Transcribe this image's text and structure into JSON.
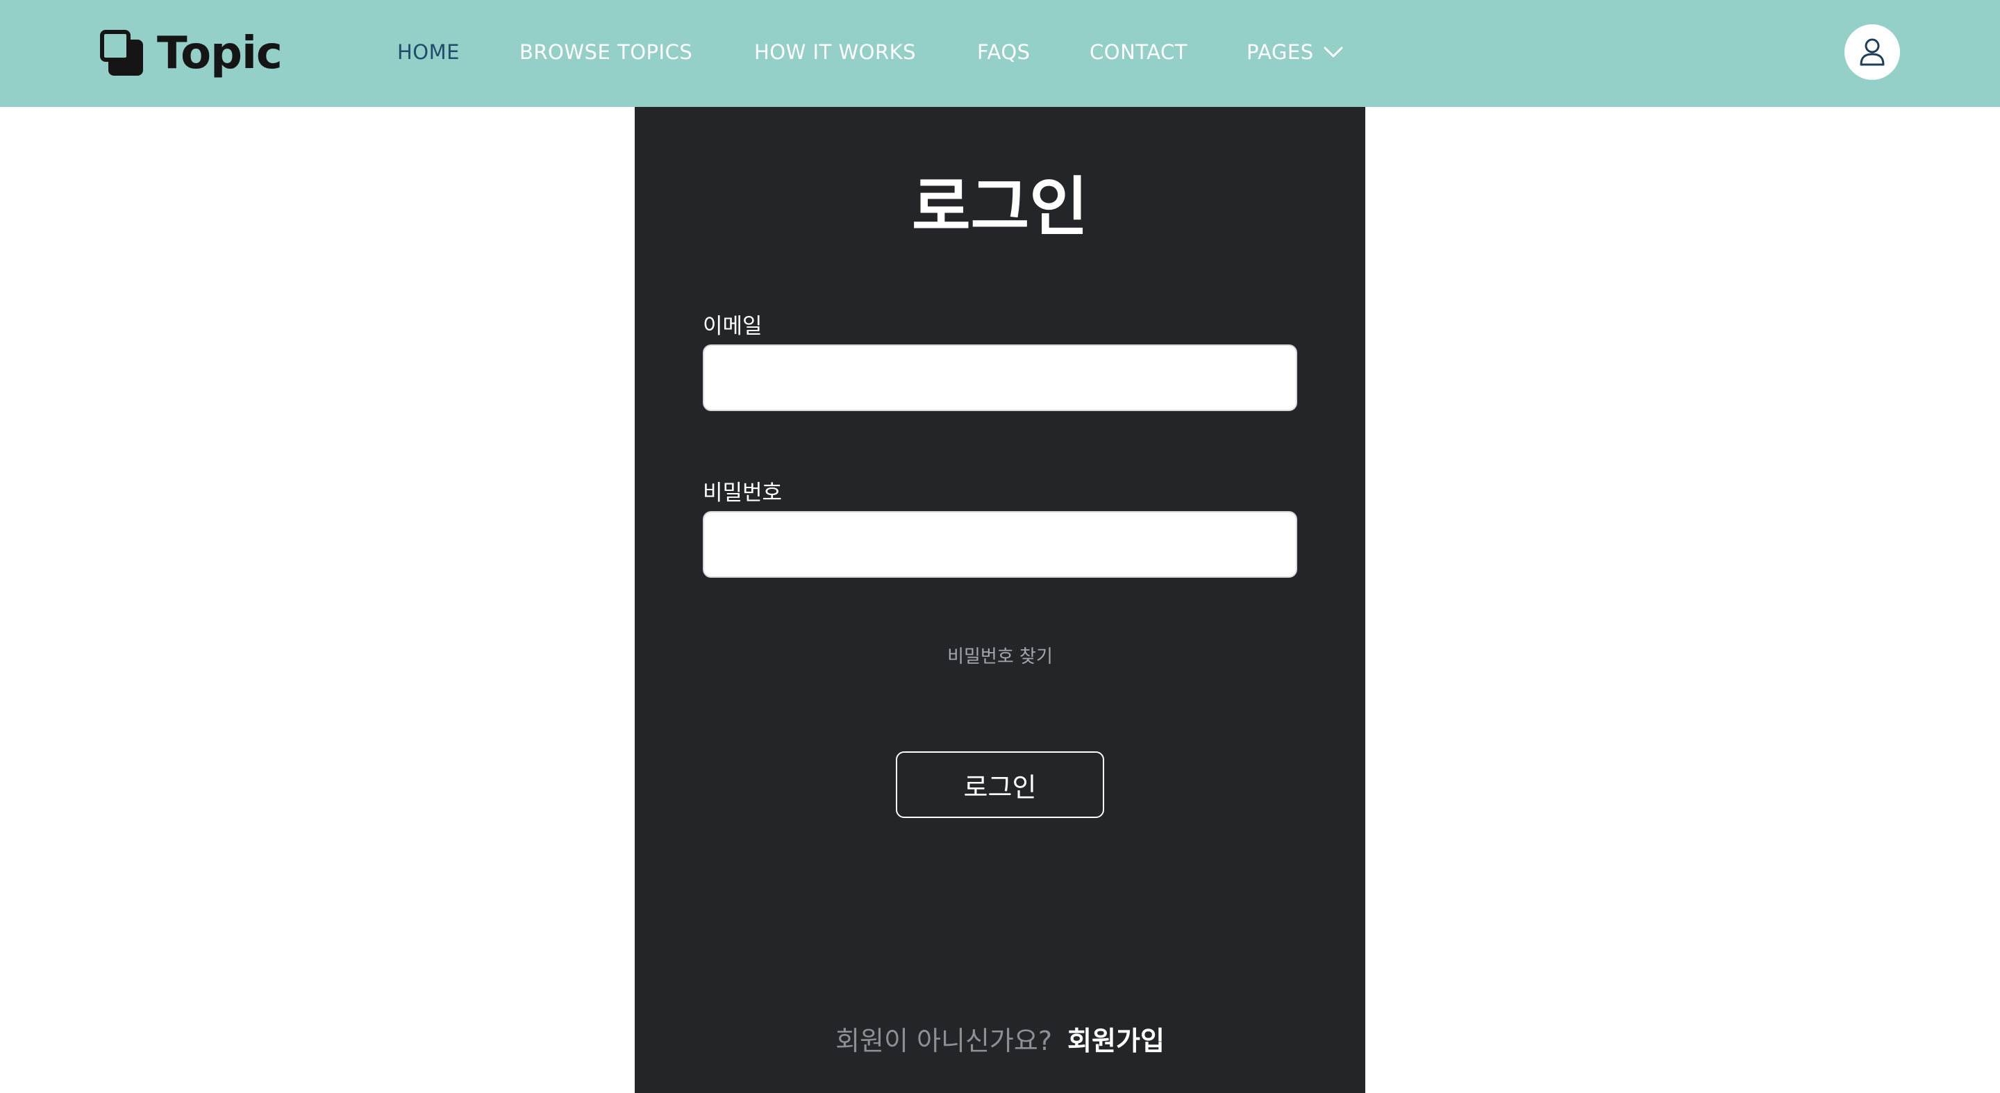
{
  "brand": {
    "name": "Topic",
    "icon": "stacked-squares-icon"
  },
  "nav": {
    "items": [
      {
        "label": "HOME",
        "active": true
      },
      {
        "label": "BROWSE TOPICS"
      },
      {
        "label": "HOW IT WORKS"
      },
      {
        "label": "FAQS"
      },
      {
        "label": "CONTACT"
      },
      {
        "label": "PAGES",
        "icon": "chevron-down-icon"
      }
    ],
    "user_icon": "user-icon"
  },
  "login": {
    "title": "로그인",
    "email_label": "이메일",
    "email_value": "",
    "password_label": "비밀번호",
    "password_value": "",
    "forgot_password": "비밀번호 찾기",
    "submit_label": "로그인",
    "signup_prompt": "회원이 아니신가요?",
    "signup_link": "회원가입"
  },
  "colors": {
    "header_bg": "#94d0c8",
    "panel_bg": "#232528",
    "nav_active": "#1e4e6a",
    "nav_text": "#ffffff",
    "muted_text": "#8c8f94"
  }
}
